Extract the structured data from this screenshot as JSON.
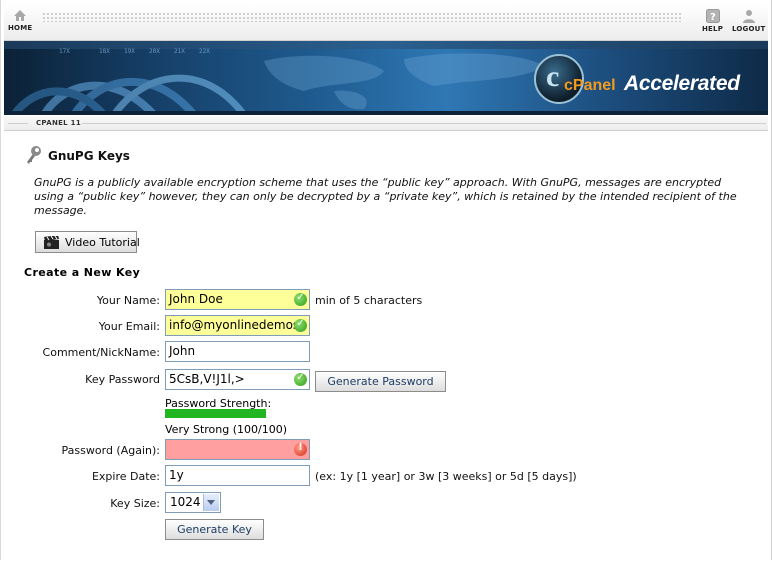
{
  "nav": {
    "home": "HOME",
    "help": "HELP",
    "logout": "LOGOUT"
  },
  "banner": {
    "logo_cpanel": "cPanel",
    "logo_accelerated": "Accelerated",
    "logo_letter": "c"
  },
  "version": "CPANEL 11",
  "page": {
    "title": "GnuPG Keys",
    "description": "GnuPG is a publicly available encryption scheme that uses the “public key” approach. With GnuPG, messages are encrypted using a “public key” however, they can only be decrypted by a “private key”, which is retained by the intended recipient of the message.",
    "video_button": "Video Tutorial",
    "section_title": "Create a New Key"
  },
  "form": {
    "name_label": "Your Name:",
    "name_value": "John Doe",
    "name_hint": "min of 5 characters",
    "email_label": "Your Email:",
    "email_value": "info@myonlinedemos",
    "comment_label": "Comment/NickName:",
    "comment_value": "John",
    "password_label": "Key Password",
    "password_value": "5CsB,V!J1l,>",
    "generate_password_button": "Generate Password",
    "strength_label": "Password Strength:",
    "strength_text": "Very Strong (100/100)",
    "strength_percent": 100,
    "password_again_label": "Password (Again):",
    "password_again_value": "",
    "expire_label": "Expire Date:",
    "expire_value": "1y",
    "expire_hint": "(ex: 1y [1 year] or 3w [3 weeks] or 5d [5 days])",
    "keysize_label": "Key Size:",
    "keysize_value": "1024",
    "generate_key_button": "Generate Key"
  },
  "colors": {
    "valid_field": "#ffff99",
    "invalid_field": "#ff9f9f",
    "strength_bar": "#21b521",
    "banner_blue": "#1e5a8e",
    "logo_orange": "#f39a1e"
  },
  "icons": {
    "home": "home-icon",
    "help": "help-icon",
    "logout": "logout-icon",
    "key": "key-icon",
    "video": "film-clapper-icon",
    "ok": "check-circle-icon",
    "error": "exclamation-circle-icon"
  }
}
